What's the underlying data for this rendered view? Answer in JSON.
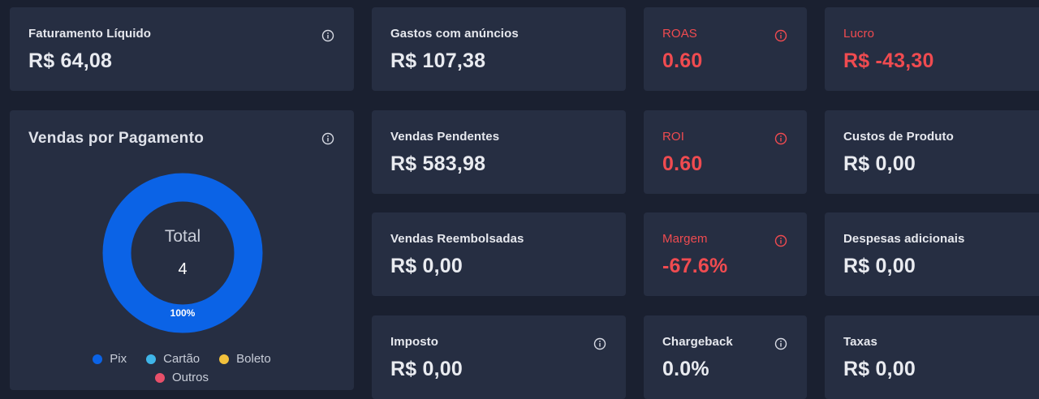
{
  "cards": {
    "faturamento": {
      "label": "Faturamento Líquido",
      "value": "R$ 64,08"
    },
    "gastos": {
      "label": "Gastos com anúncios",
      "value": "R$ 107,38"
    },
    "roas": {
      "label": "ROAS",
      "value": "0.60"
    },
    "lucro": {
      "label": "Lucro",
      "value": "R$ -43,30"
    },
    "pendentes": {
      "label": "Vendas Pendentes",
      "value": "R$ 583,98"
    },
    "roi": {
      "label": "ROI",
      "value": "0.60"
    },
    "custos": {
      "label": "Custos de Produto",
      "value": "R$ 0,00"
    },
    "reembolsadas": {
      "label": "Vendas Reembolsadas",
      "value": "R$ 0,00"
    },
    "margem": {
      "label": "Margem",
      "value": "-67.6%"
    },
    "despesas": {
      "label": "Despesas adicionais",
      "value": "R$ 0,00"
    },
    "imposto": {
      "label": "Imposto",
      "value": "R$ 0,00"
    },
    "chargeback": {
      "label": "Chargeback",
      "value": "0.0%"
    },
    "taxas": {
      "label": "Taxas",
      "value": "R$ 0,00"
    }
  },
  "payments": {
    "title": "Vendas por Pagamento",
    "center_label": "Total",
    "total": "4",
    "pix_share_label": "100%"
  },
  "legend": [
    {
      "label": "Pix",
      "color": "#0b63e6"
    },
    {
      "label": "Cartão",
      "color": "#3fb5e8"
    },
    {
      "label": "Boleto",
      "color": "#f2c13c"
    },
    {
      "label": "Outros",
      "color": "#e8506a"
    }
  ],
  "chart_data": {
    "type": "pie",
    "categories": [
      "Pix",
      "Cartão",
      "Boleto",
      "Outros"
    ],
    "values": [
      4,
      0,
      0,
      0
    ],
    "title": "Vendas por Pagamento"
  },
  "colors": {
    "background": "#1a2030",
    "card": "#262e42",
    "negative": "#f04b50",
    "pix": "#0b63e6"
  },
  "icons": {
    "info": "info-circle-icon"
  }
}
